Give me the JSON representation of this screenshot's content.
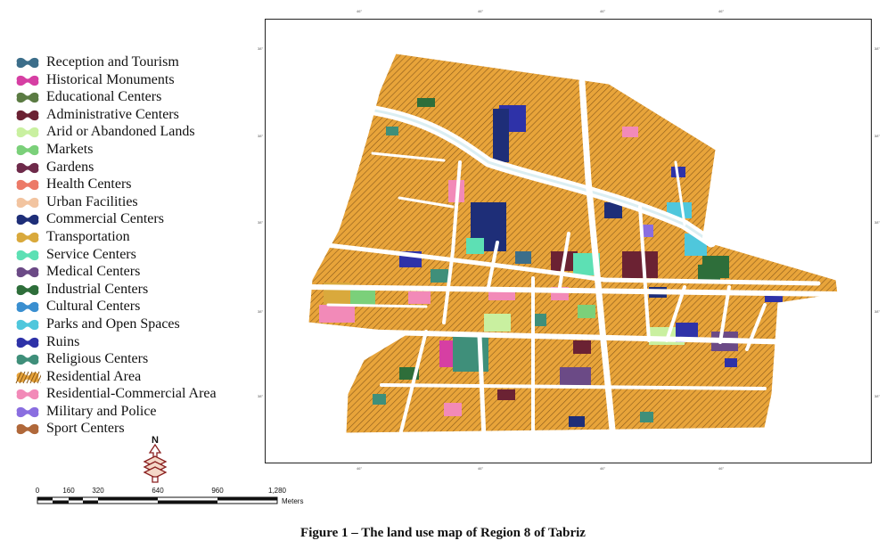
{
  "legend": {
    "items": [
      {
        "label": "Reception and Tourism",
        "color": "#3c6e8a"
      },
      {
        "label": "Historical Monuments",
        "color": "#d63fa3"
      },
      {
        "label": "Educational Centers",
        "color": "#5b7b43"
      },
      {
        "label": "Administrative Centers",
        "color": "#6b2233"
      },
      {
        "label": "Arid or Abandoned Lands",
        "color": "#c9f0a0"
      },
      {
        "label": "Markets",
        "color": "#7bd07a"
      },
      {
        "label": "Gardens",
        "color": "#6e2a4a"
      },
      {
        "label": "Health Centers",
        "color": "#ec7a68"
      },
      {
        "label": "Urban Facilities",
        "color": "#f2c4a0"
      },
      {
        "label": "Commercial Centers",
        "color": "#1e2e78"
      },
      {
        "label": "Transportation",
        "color": "#d9a93c"
      },
      {
        "label": "Service Centers",
        "color": "#5de0b4"
      },
      {
        "label": "Medical Centers",
        "color": "#6b4a86"
      },
      {
        "label": "Industrial Centers",
        "color": "#2e6e3a"
      },
      {
        "label": "Cultural Centers",
        "color": "#3a8fd0"
      },
      {
        "label": "Parks and Open Spaces",
        "color": "#4fc7dc"
      },
      {
        "label": "Ruins",
        "color": "#2e32a8"
      },
      {
        "label": "Religious Centers",
        "color": "#3f8f7a"
      },
      {
        "label": "Residential Area",
        "color": "#e8a43a"
      },
      {
        "label": "Residential-Commercial Area",
        "color": "#f28ab8"
      },
      {
        "label": "Military and Police",
        "color": "#8a6ee0"
      },
      {
        "label": "Sport Centers",
        "color": "#b0683a"
      }
    ]
  },
  "map": {
    "tick_top": [
      "46°",
      "46°",
      "46°",
      "46°"
    ],
    "tick_bottom": [
      "46°",
      "46°",
      "46°",
      "46°"
    ],
    "tick_left": [
      "38°",
      "38°",
      "38°",
      "38°",
      "38°"
    ],
    "tick_right": [
      "38°",
      "38°",
      "38°",
      "38°",
      "38°"
    ]
  },
  "north_arrow": {
    "label": "N"
  },
  "scale_bar": {
    "labels": [
      "0",
      "160",
      "320",
      "640",
      "960",
      "1,280"
    ],
    "units": "Meters"
  },
  "caption": "Figure 1 – The land use map of Region 8 of Tabriz"
}
